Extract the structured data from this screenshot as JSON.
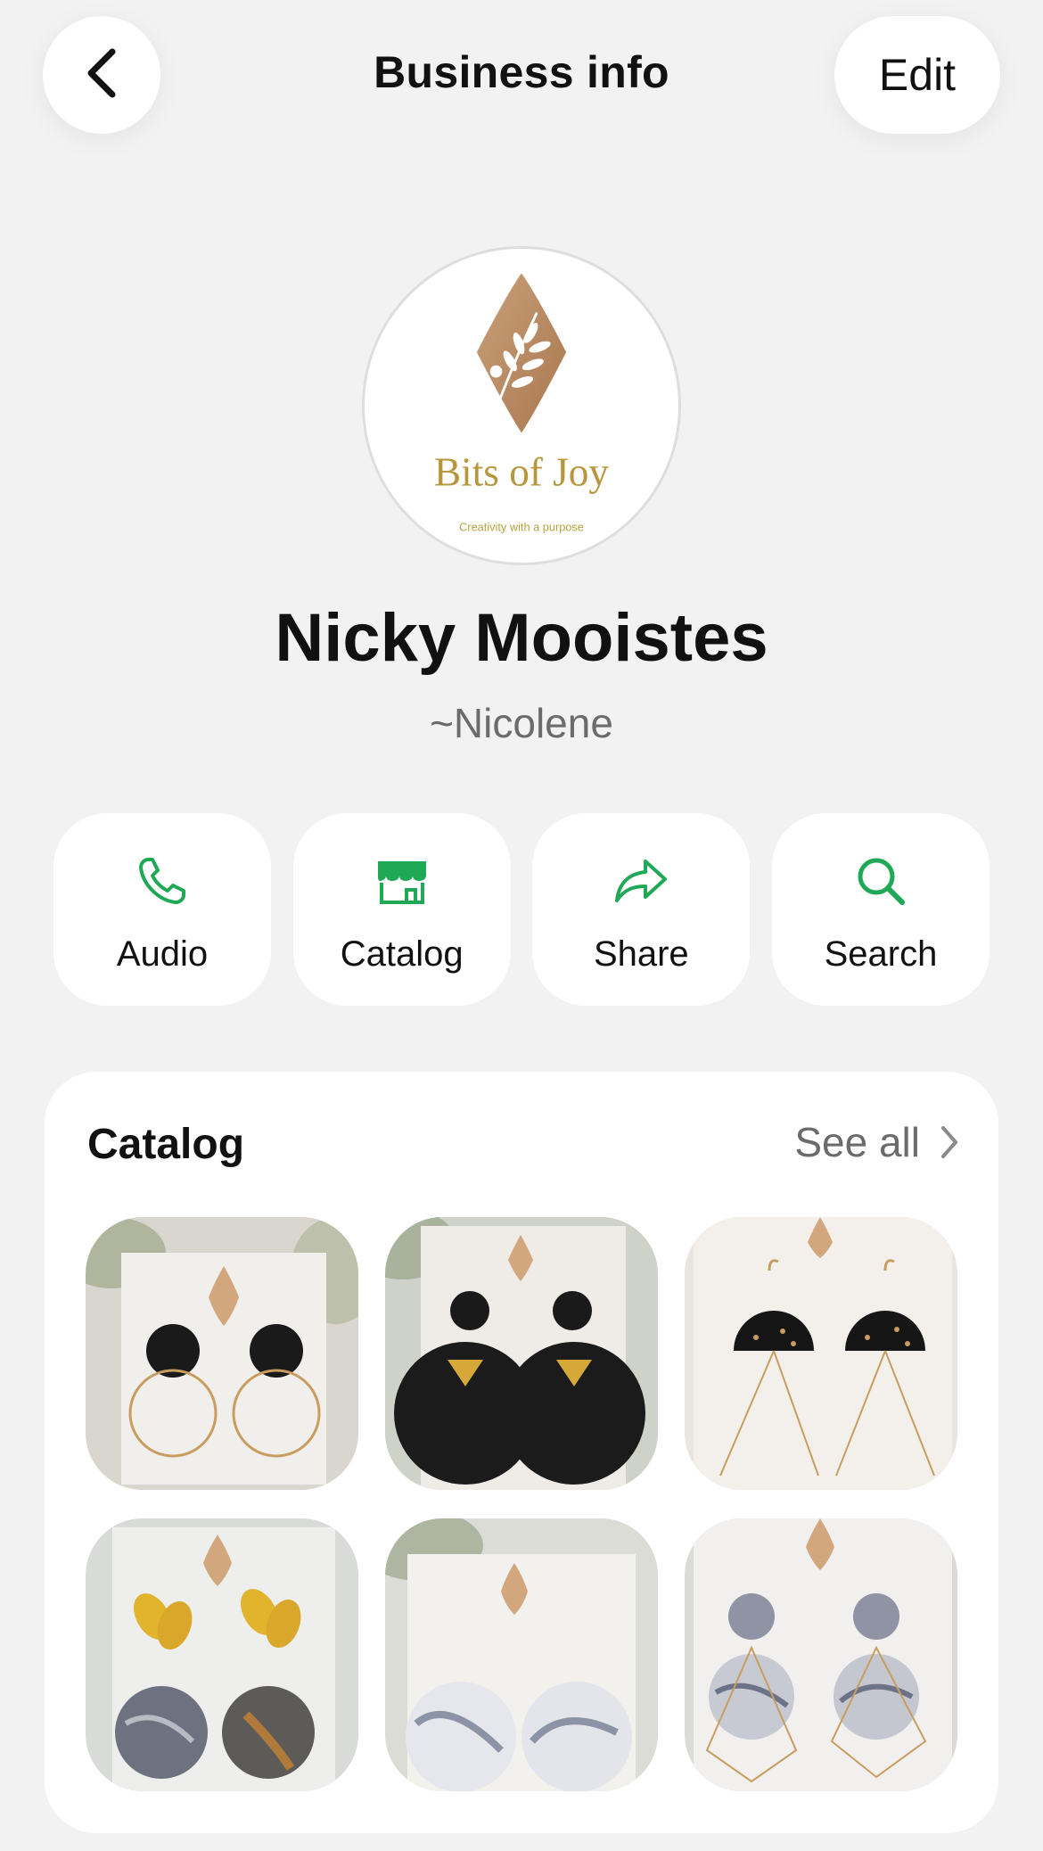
{
  "header": {
    "title": "Business info",
    "edit_label": "Edit",
    "back_icon": "chevron-left-icon"
  },
  "profile": {
    "logo_text": "Bits of Joy",
    "logo_tagline": "Creativity with a purpose",
    "name": "Nicky Mooistes",
    "subtitle": "~Nicolene"
  },
  "actions": [
    {
      "label": "Audio",
      "icon": "phone-icon"
    },
    {
      "label": "Catalog",
      "icon": "storefront-icon"
    },
    {
      "label": "Share",
      "icon": "share-arrow-icon"
    },
    {
      "label": "Search",
      "icon": "search-icon"
    }
  ],
  "catalog": {
    "title": "Catalog",
    "see_all_label": "See all",
    "items": [
      {
        "image": "black-dot-gold-hoop-earrings"
      },
      {
        "image": "black-circle-gold-triangle-earrings"
      },
      {
        "image": "black-gold-fleck-semicircle-earrings"
      },
      {
        "image": "gold-leaf-marble-drop-earrings"
      },
      {
        "image": "white-marble-circle-earrings"
      },
      {
        "image": "grey-marble-geometric-earrings"
      }
    ]
  },
  "colors": {
    "accent": "#1fa855",
    "background": "#f2f2f2",
    "card": "#ffffff",
    "logo_bronze": "#b98a62",
    "logo_gold": "#b8963e"
  }
}
